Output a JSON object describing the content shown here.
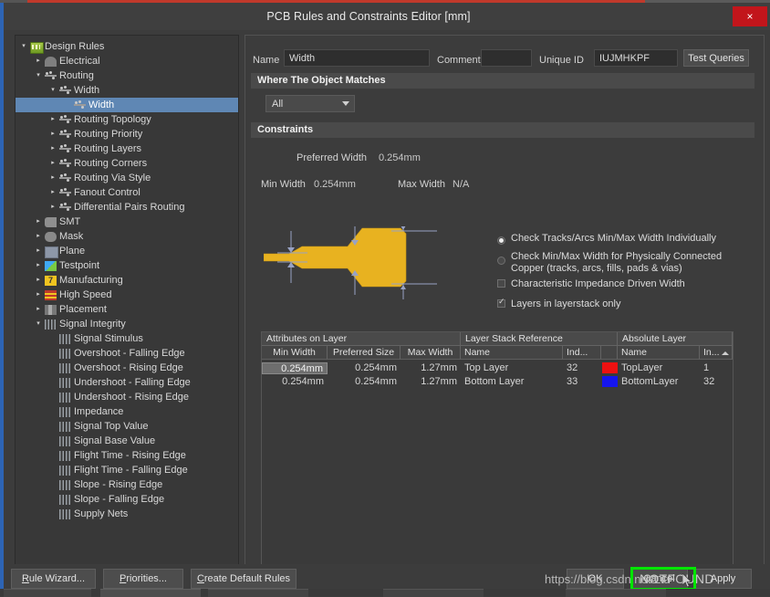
{
  "window": {
    "title": "PCB Rules and Constraints Editor [mm]",
    "close_label": "×"
  },
  "tree": {
    "nodes": [
      {
        "label": "Design Rules",
        "depth": 0,
        "state": "open",
        "icon": "folder-icon",
        "selected": false
      },
      {
        "label": "Electrical",
        "depth": 1,
        "state": "closed",
        "icon": "electrical-icon",
        "selected": false
      },
      {
        "label": "Routing",
        "depth": 1,
        "state": "open",
        "icon": "routing-icon",
        "selected": false
      },
      {
        "label": "Width",
        "depth": 2,
        "state": "open",
        "icon": "routing-icon",
        "selected": false
      },
      {
        "label": "Width",
        "depth": 3,
        "state": "leaf",
        "icon": "routing-icon",
        "selected": true
      },
      {
        "label": "Routing Topology",
        "depth": 2,
        "state": "closed",
        "icon": "routing-icon",
        "selected": false
      },
      {
        "label": "Routing Priority",
        "depth": 2,
        "state": "closed",
        "icon": "routing-icon",
        "selected": false
      },
      {
        "label": "Routing Layers",
        "depth": 2,
        "state": "closed",
        "icon": "routing-icon",
        "selected": false
      },
      {
        "label": "Routing Corners",
        "depth": 2,
        "state": "closed",
        "icon": "routing-icon",
        "selected": false
      },
      {
        "label": "Routing Via Style",
        "depth": 2,
        "state": "closed",
        "icon": "routing-icon",
        "selected": false
      },
      {
        "label": "Fanout Control",
        "depth": 2,
        "state": "closed",
        "icon": "routing-icon",
        "selected": false
      },
      {
        "label": "Differential Pairs Routing",
        "depth": 2,
        "state": "closed",
        "icon": "routing-icon",
        "selected": false
      },
      {
        "label": "SMT",
        "depth": 1,
        "state": "closed",
        "icon": "smt-icon",
        "selected": false
      },
      {
        "label": "Mask",
        "depth": 1,
        "state": "closed",
        "icon": "mask-icon",
        "selected": false
      },
      {
        "label": "Plane",
        "depth": 1,
        "state": "closed",
        "icon": "plane-icon",
        "selected": false
      },
      {
        "label": "Testpoint",
        "depth": 1,
        "state": "closed",
        "icon": "testpoint-icon",
        "selected": false
      },
      {
        "label": "Manufacturing",
        "depth": 1,
        "state": "closed",
        "icon": "manufacturing-icon",
        "selected": false
      },
      {
        "label": "High Speed",
        "depth": 1,
        "state": "closed",
        "icon": "high-speed-icon",
        "selected": false
      },
      {
        "label": "Placement",
        "depth": 1,
        "state": "closed",
        "icon": "placement-icon",
        "selected": false
      },
      {
        "label": "Signal Integrity",
        "depth": 1,
        "state": "open",
        "icon": "signal-integrity-icon",
        "selected": false
      },
      {
        "label": "Signal Stimulus",
        "depth": 2,
        "state": "leaf",
        "icon": "signal-integrity-icon",
        "selected": false
      },
      {
        "label": "Overshoot - Falling Edge",
        "depth": 2,
        "state": "leaf",
        "icon": "signal-integrity-icon",
        "selected": false
      },
      {
        "label": "Overshoot - Rising Edge",
        "depth": 2,
        "state": "leaf",
        "icon": "signal-integrity-icon",
        "selected": false
      },
      {
        "label": "Undershoot - Falling Edge",
        "depth": 2,
        "state": "leaf",
        "icon": "signal-integrity-icon",
        "selected": false
      },
      {
        "label": "Undershoot - Rising Edge",
        "depth": 2,
        "state": "leaf",
        "icon": "signal-integrity-icon",
        "selected": false
      },
      {
        "label": "Impedance",
        "depth": 2,
        "state": "leaf",
        "icon": "signal-integrity-icon",
        "selected": false
      },
      {
        "label": "Signal Top Value",
        "depth": 2,
        "state": "leaf",
        "icon": "signal-integrity-icon",
        "selected": false
      },
      {
        "label": "Signal Base Value",
        "depth": 2,
        "state": "leaf",
        "icon": "signal-integrity-icon",
        "selected": false
      },
      {
        "label": "Flight Time - Rising Edge",
        "depth": 2,
        "state": "leaf",
        "icon": "signal-integrity-icon",
        "selected": false
      },
      {
        "label": "Flight Time - Falling Edge",
        "depth": 2,
        "state": "leaf",
        "icon": "signal-integrity-icon",
        "selected": false
      },
      {
        "label": "Slope - Rising Edge",
        "depth": 2,
        "state": "leaf",
        "icon": "signal-integrity-icon",
        "selected": false
      },
      {
        "label": "Slope - Falling Edge",
        "depth": 2,
        "state": "leaf",
        "icon": "signal-integrity-icon",
        "selected": false
      },
      {
        "label": "Supply Nets",
        "depth": 2,
        "state": "leaf",
        "icon": "signal-integrity-icon",
        "selected": false
      }
    ]
  },
  "form": {
    "name_label": "Name",
    "name_value": "Width",
    "comment_label": "Comment",
    "comment_value": "",
    "unique_id_label": "Unique ID",
    "unique_id_value": "IUJMHKPF",
    "test_queries_label": "Test Queries"
  },
  "where_section": {
    "header": "Where The Object Matches",
    "scope_value": "All"
  },
  "constraints": {
    "header": "Constraints",
    "preferred_width_label": "Preferred Width",
    "preferred_width_value": "0.254mm",
    "min_width_label": "Min Width",
    "min_width_value": "0.254mm",
    "max_width_label": "Max Width",
    "max_width_value": "N/A",
    "options": {
      "check_individually": "Check Tracks/Arcs Min/Max Width Individually",
      "check_connected_line1": "Check Min/Max Width for Physically Connected",
      "check_connected_line2": "Copper (tracks, arcs, fills, pads & vias)",
      "characteristic_impedance": "Characteristic Impedance Driven Width",
      "layers_in_layerstack": "Layers in layerstack only"
    },
    "track_color": "#e8b220"
  },
  "table": {
    "groups": [
      "Attributes on Layer",
      "Layer Stack Reference",
      "Absolute Layer"
    ],
    "columns": [
      "Min Width",
      "Preferred Size",
      "Max Width",
      "Name",
      "Ind...",
      "",
      "Name",
      "In..."
    ],
    "rows": [
      {
        "min_width": "0.254mm",
        "preferred_size": "0.254mm",
        "max_width": "1.27mm",
        "stack_name": "Top Layer",
        "stack_index": "32",
        "color": "#ee1111",
        "abs_name": "TopLayer",
        "abs_index": "1",
        "selected": true
      },
      {
        "min_width": "0.254mm",
        "preferred_size": "0.254mm",
        "max_width": "1.27mm",
        "stack_name": "Bottom Layer",
        "stack_index": "33",
        "color": "#1515ee",
        "abs_name": "BottomLayer",
        "abs_index": "32",
        "selected": false
      }
    ]
  },
  "footer": {
    "rule_wizard": "Rule Wizard...",
    "priorities": "Priorities...",
    "create_default_rules": "Create Default Rules",
    "ok": "OK",
    "cancel": "Cancel",
    "apply": "Apply"
  },
  "overlay": {
    "watermark": "https://blog.csdn.net/Liu",
    "notfound": "NOTFOUND",
    "highlight_color": "#00e500"
  }
}
